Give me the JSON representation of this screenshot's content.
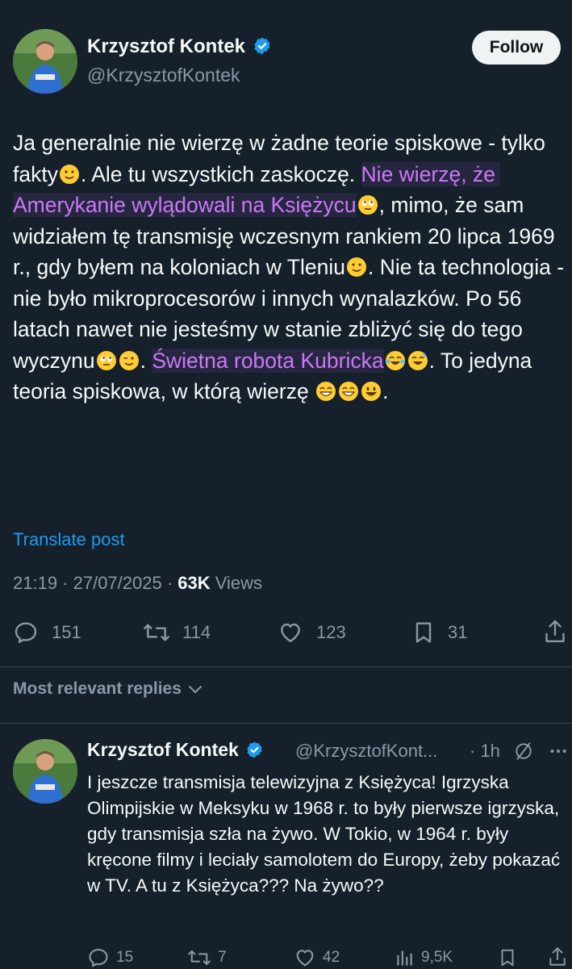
{
  "post": {
    "author_name": "Krzysztof Kontek",
    "author_handle": "@KrzysztofKontek",
    "follow_label": "Follow",
    "text_1": "Ja generalnie nie wierzę w żadne teorie spiskowe - tylko fakty",
    "text_2": ". Ale tu wszystkich zaskoczę. ",
    "text_hl1": "Nie wierzę, że Amerykanie wylądowali na Księżycu",
    "text_3": ", mimo, że sam widziałem tę transmisję wczesnym rankiem 20 lipca 1969 r., gdy byłem na koloniach w Tleniu",
    "text_4": ". Nie ta technologia - nie było mikroprocesorów i innych wynalazków. Po 56 latach nawet nie jesteśmy w stanie zbliżyć się do tego wyczynu",
    "text_5": ". ",
    "text_hl2": "Świetna robota Kubricka",
    "text_6": ". To jedyna teoria spiskowa, w którą wierzę ",
    "text_7": ".",
    "translate_label": "Translate post",
    "time": "21:19 · 27/07/2025 · ",
    "views_count": "63K",
    "views_label": " Views",
    "replies": "151",
    "reposts": "114",
    "likes": "123",
    "bookmarks": "31"
  },
  "replies_header": "Most relevant replies",
  "reply": {
    "author_name": "Krzysztof Kontek",
    "author_handle": "@KrzysztofKont...",
    "age": "· 1h",
    "text": "I jeszcze transmisja telewizyjna z Księżyca! Igrzyska Olimpijskie w Meksyku w 1968 r. to były pierwsze igrzyska, gdy transmisja szła na żywo. W Tokio, w 1964 r. były kręcone filmy i leciały samolotem do Europy, żeby pokazać w TV. A tu z Księżyca??? Na żywo??",
    "replies": "15",
    "reposts": "7",
    "likes": "42",
    "views": "9,5K"
  },
  "colors": {
    "accent": "#1d9bf0",
    "highlight": "#c979f5",
    "background": "#15202b",
    "muted": "#8b98a5"
  },
  "icons": [
    "verified-badge-icon",
    "reply-icon",
    "repost-icon",
    "like-icon",
    "bookmark-icon",
    "share-icon",
    "views-icon",
    "grok-icon",
    "more-icon",
    "chevron-down-icon"
  ]
}
